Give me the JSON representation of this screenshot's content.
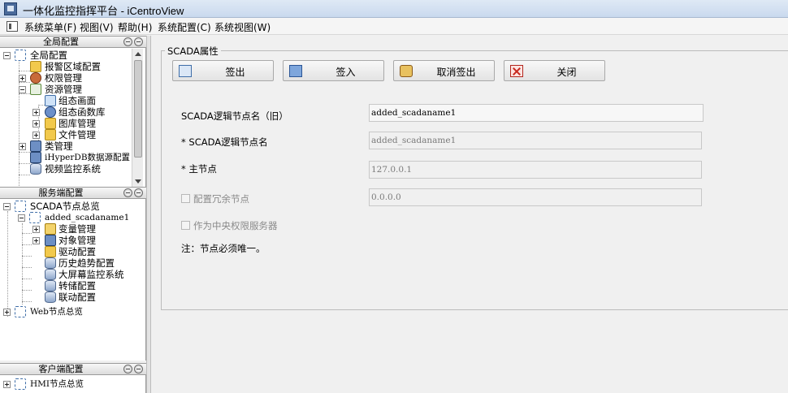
{
  "window": {
    "title": "一体化监控指挥平台 - iCentroView"
  },
  "menu": {
    "items": [
      {
        "label": "系统菜单(F)"
      },
      {
        "label": "视图(V)"
      },
      {
        "label": "帮助(H)"
      },
      {
        "label": "系统配置(C)"
      },
      {
        "label": "系统视图(W)"
      }
    ]
  },
  "panels": {
    "global": {
      "title": "全局配置",
      "items": [
        "全局配置",
        "报警区域配置",
        "权限管理",
        "资源管理",
        "组态画面",
        "组态函数库",
        "图库管理",
        "文件管理",
        "类管理",
        "iHyperDB数据源配置",
        "视频监控系统"
      ]
    },
    "server": {
      "title": "服务端配置",
      "items": [
        "SCADA节点总览",
        "added_scadaname1",
        "变量管理",
        "对象管理",
        "驱动配置",
        "历史趋势配置",
        "大屏幕监控系统",
        "转储配置",
        "联动配置",
        "Web节点总览"
      ]
    },
    "client": {
      "title": "客户端配置",
      "items": [
        "HMI节点总览"
      ]
    }
  },
  "main": {
    "group_title": "SCADA属性",
    "buttons": {
      "checkout": "签出",
      "checkin": "签入",
      "cancel_checkout": "取消签出",
      "close": "关闭"
    },
    "form": {
      "old_name_label": "SCADA逻辑节点名（旧）",
      "old_name_value": "added_scadaname1",
      "name_label": "* SCADA逻辑节点名",
      "name_value": "added_scadaname1",
      "master_label": "* 主节点",
      "master_value": "127.0.0.1",
      "redundant_label": "配置冗余节点",
      "redundant_value": "0.0.0.0",
      "central_auth_label": "作为中央权限服务器",
      "note": "注：节点必须唯一。"
    }
  }
}
